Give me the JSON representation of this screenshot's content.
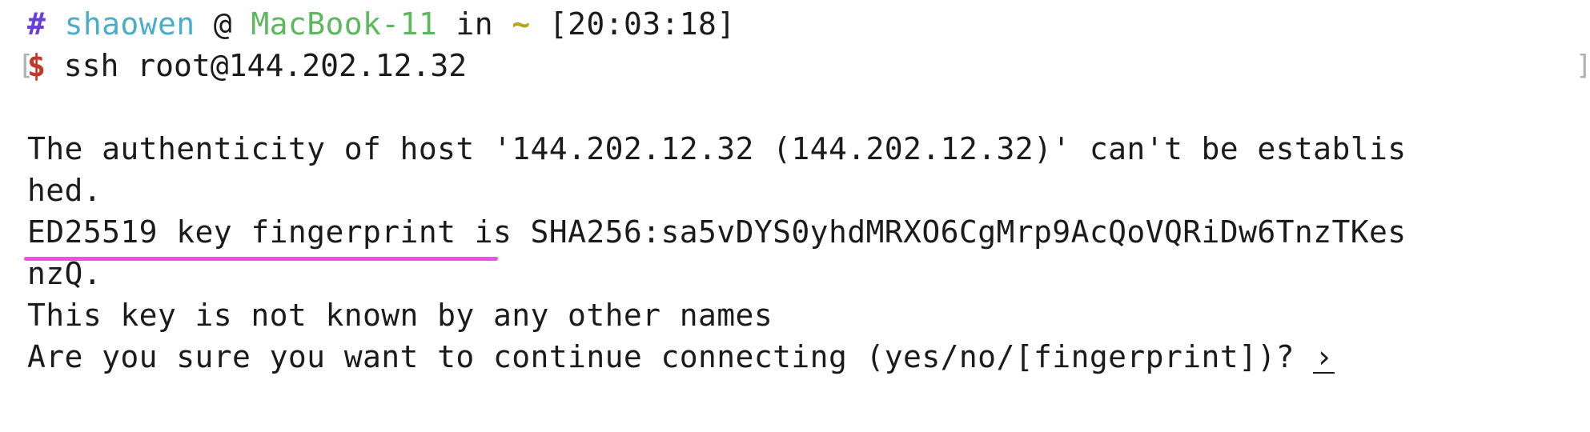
{
  "prompt": {
    "hash": "#",
    "user": "shaowen",
    "at": "@",
    "host": "MacBook-11",
    "in": "in",
    "cwd": "~",
    "time": "[20:03:18]",
    "dollar": "$",
    "command": "ssh root@144.202.12.32",
    "left_bracket": "[",
    "right_bracket": "]"
  },
  "output": {
    "line1": "The authenticity of host '144.202.12.32 (144.202.12.32)' can't be establis",
    "line2": "hed.",
    "line3_highlight": "ED25519 key fingerprint",
    "line3_rest": " is SHA256:sa5vDYS0yhdMRXO6CgMrp9AcQoVQRiDw6TnzTKes",
    "line4": "nzQ.",
    "line5": "This key is not known by any other names",
    "line6": "Are you sure you want to continue connecting (yes/no/[fingerprint])? ",
    "cursor": "›"
  },
  "colors": {
    "hash": "#6a3fd6",
    "user": "#4aaec9",
    "host": "#5cb85c",
    "tilde": "#b8a51a",
    "dollar": "#c0392b",
    "annotation_underline": "#ee4fe6"
  }
}
